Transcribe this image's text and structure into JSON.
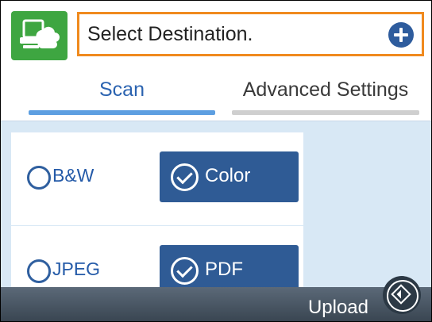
{
  "header": {
    "destination_label": "Select Destination.",
    "app_icon": "scan-to-cloud-icon",
    "add_icon": "plus-icon"
  },
  "tabs": [
    {
      "label": "Scan",
      "selected": true
    },
    {
      "label": "Advanced Settings",
      "selected": false
    }
  ],
  "scan_options": {
    "color_mode": {
      "unselected_label": "B&W",
      "selected_label": "Color"
    },
    "file_format": {
      "unselected_label": "JPEG",
      "selected_label": "PDF"
    }
  },
  "bottom_bar": {
    "upload_label": "Upload",
    "start_icon": "start-diamond-icon"
  },
  "colors": {
    "accent": "#2f5b95",
    "header_icon_bg": "#3ea641",
    "highlight_border": "#f08a1e",
    "tab_active": "#2b63b0"
  }
}
